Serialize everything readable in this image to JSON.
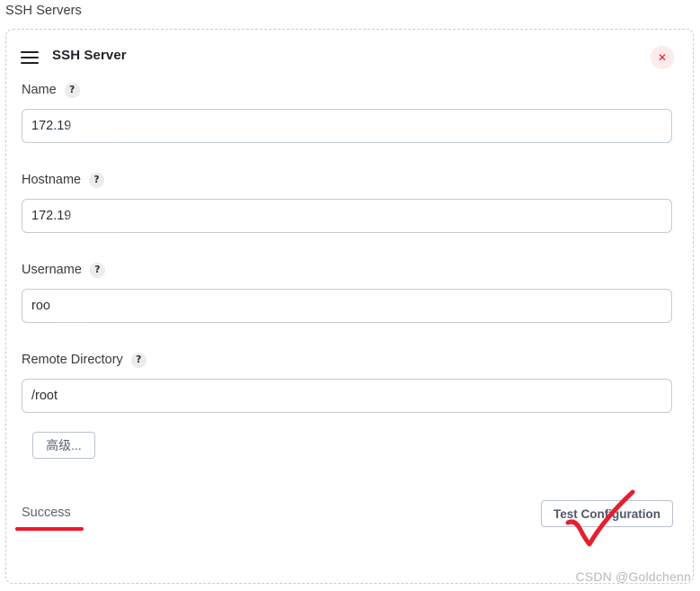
{
  "page": {
    "heading": "SSH Servers",
    "watermark": "CSDN @Goldchenn"
  },
  "card": {
    "title": "SSH Server",
    "menu_icon": "hamburger-menu-icon",
    "close_icon": "close-x-icon",
    "close_label": "✕",
    "accent_close_color": "#e8192c",
    "border_color": "#c3ccd4"
  },
  "fields": [
    {
      "label": "Name",
      "help": "?",
      "value": "172.19",
      "masked": true,
      "placeholder": ""
    },
    {
      "label": "Hostname",
      "help": "?",
      "value": "172.19",
      "masked": true,
      "placeholder": ""
    },
    {
      "label": "Username",
      "help": "?",
      "value": "roo",
      "masked": true,
      "placeholder": ""
    },
    {
      "label": "Remote Directory",
      "help": "?",
      "value": "/root",
      "masked": false,
      "placeholder": ""
    }
  ],
  "buttons": {
    "advanced_label": "高级...",
    "test_configuration_label": "Test Configuration"
  },
  "status": {
    "text": "Success",
    "color": "#5a6475"
  },
  "annotations": {
    "underline_color": "#f2162a",
    "check_color": "#e5202e",
    "underline_target": "status-text",
    "check_target": "test-configuration-button"
  }
}
